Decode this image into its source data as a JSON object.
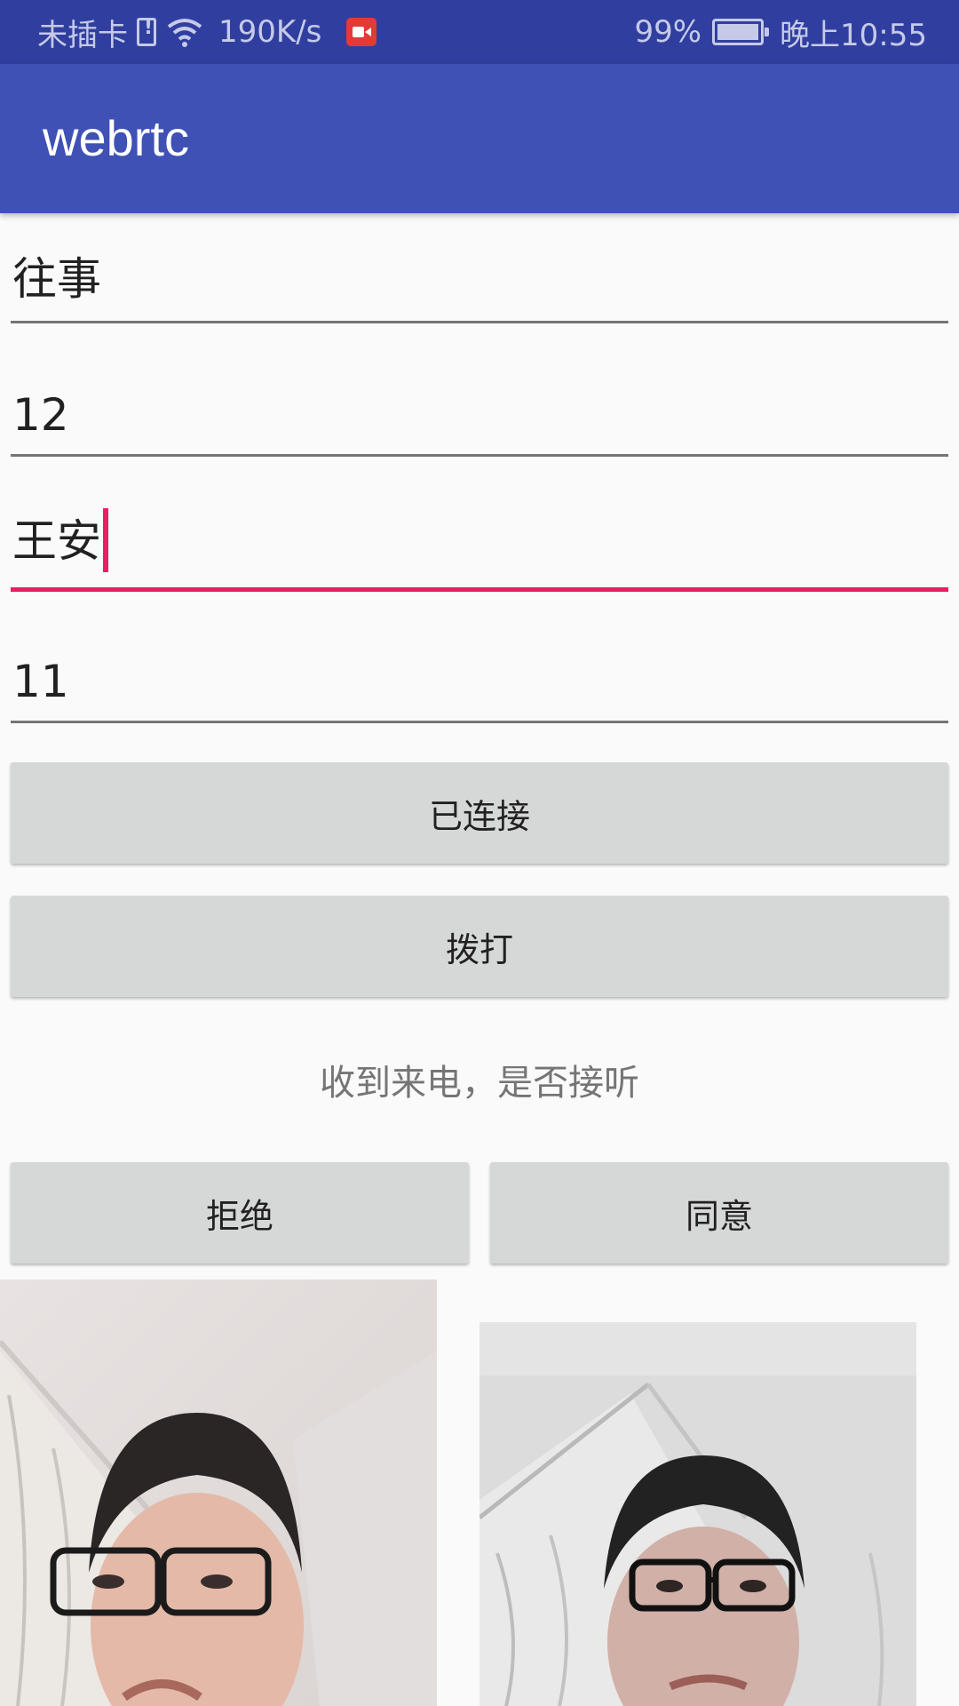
{
  "status_bar": {
    "carrier": "未插卡",
    "speed": "190K/s",
    "battery": "99%",
    "time": "晚上10:55",
    "icons": [
      "sim-alert-icon",
      "wifi-icon",
      "screen-record-icon",
      "battery-charging-icon"
    ]
  },
  "app_bar": {
    "title": "webrtc"
  },
  "form": {
    "field1": "往事",
    "field2": "12",
    "field3": "王安",
    "field4": "11"
  },
  "buttons": {
    "connect": "已连接",
    "dial": "拨打",
    "reject": "拒绝",
    "accept": "同意"
  },
  "call_prompt": "收到来电，是否接听",
  "colors": {
    "status_bar": "#303f9f",
    "app_bar": "#3f51b5",
    "accent": "#e91e63",
    "button": "#d6d7d7"
  }
}
